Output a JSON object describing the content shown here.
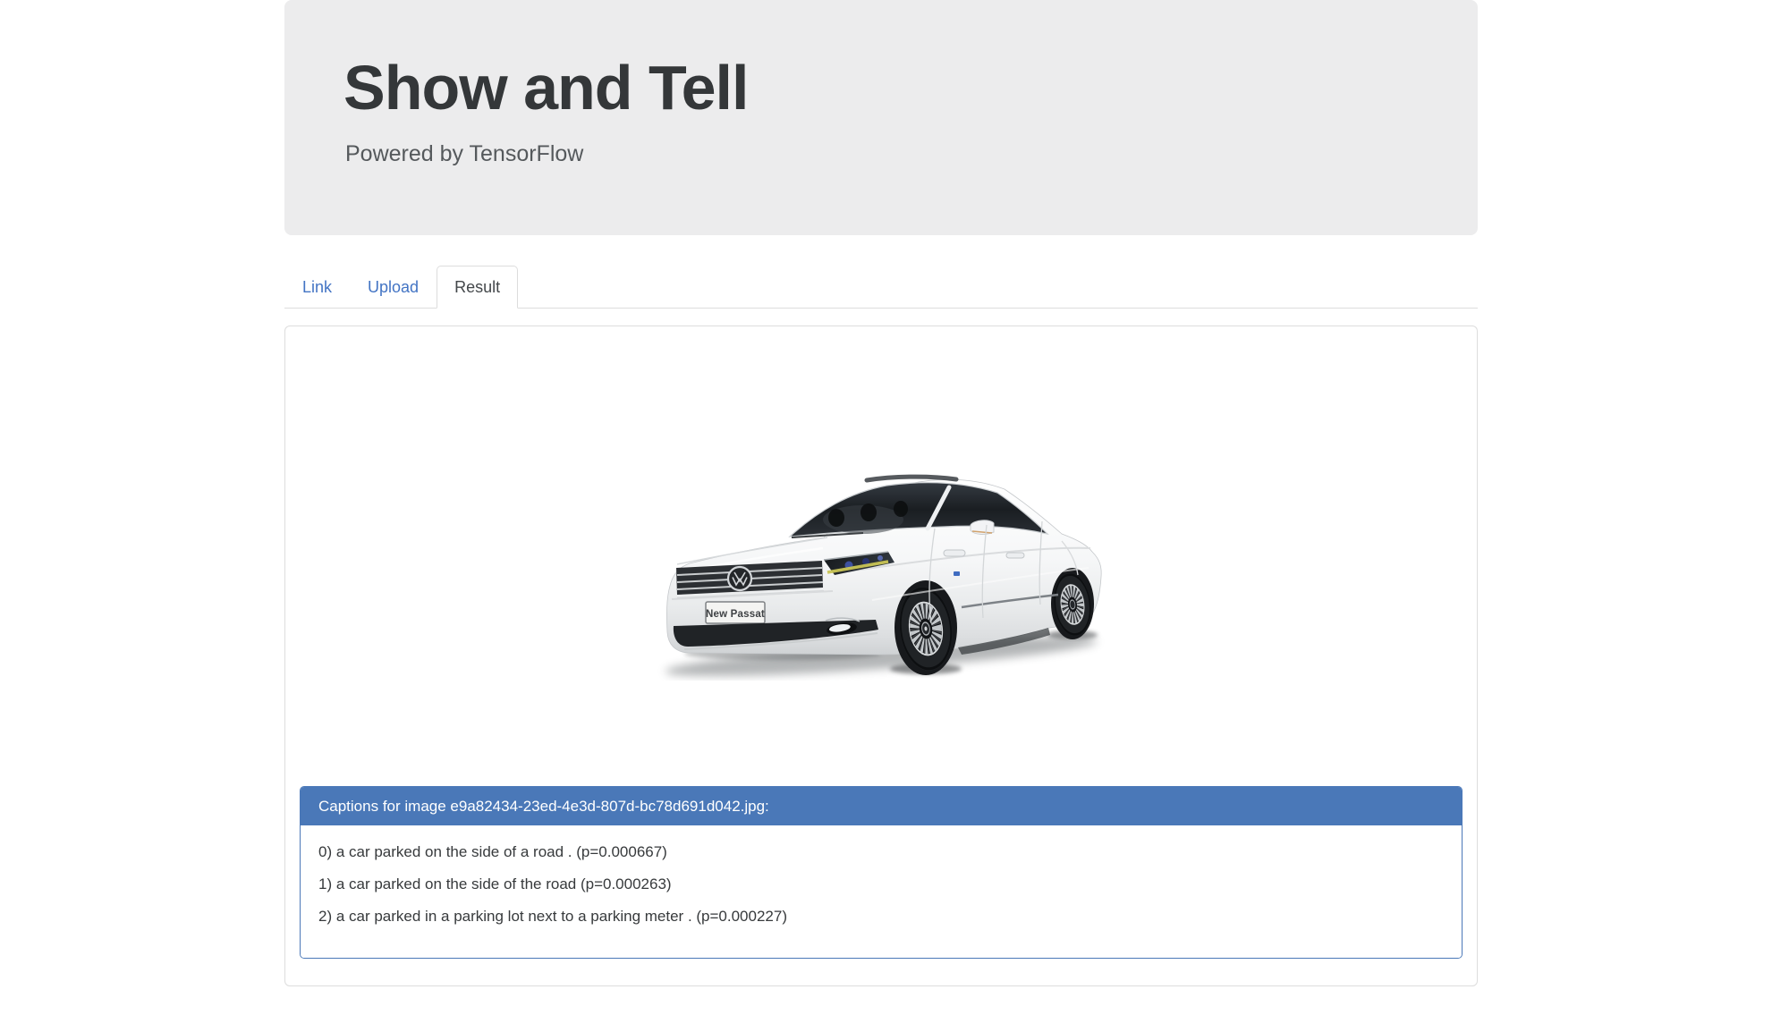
{
  "header": {
    "title": "Show and Tell",
    "subtitle": "Powered by TensorFlow"
  },
  "tabs": [
    {
      "label": "Link",
      "active": false
    },
    {
      "label": "Upload",
      "active": false
    },
    {
      "label": "Result",
      "active": true
    }
  ],
  "result_image": {
    "description": "white Volkswagen New Passat sedan, three-quarter front-left studio photo",
    "plate_text": "New Passat",
    "badge_text": "VW"
  },
  "captions": {
    "heading": "Captions for image e9a82434-23ed-4e3d-807d-bc78d691d042.jpg:",
    "items": [
      "0) a car parked on the side of a road . (p=0.000667)",
      "1) a car parked on the side of the road (p=0.000263)",
      "2) a car parked in a parking lot next to a parking meter . (p=0.000227)"
    ]
  },
  "colors": {
    "panel_blue": "#4a78b8",
    "link_blue": "#4374c4",
    "jumbotron_bg": "#ececed",
    "tab_border": "#dddddd",
    "text_dark": "#373a3c"
  }
}
